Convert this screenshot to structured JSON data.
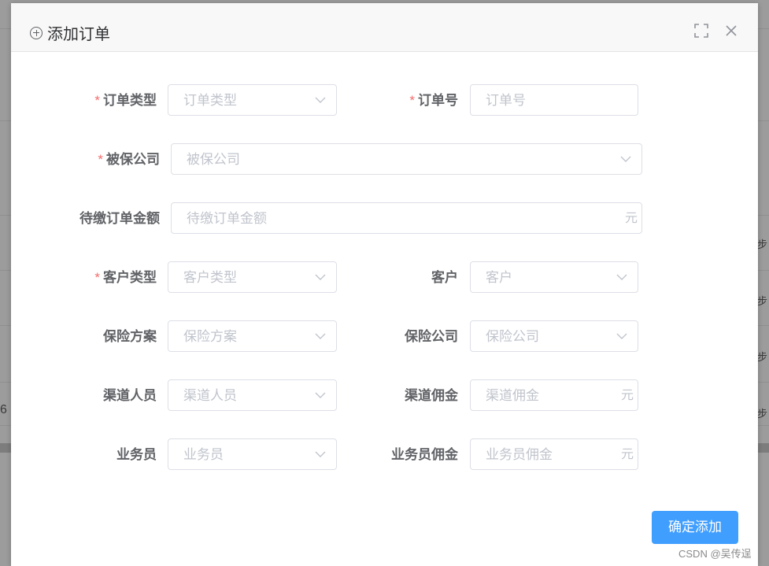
{
  "dialog": {
    "title": "添加订单",
    "submit_label": "确定添加"
  },
  "form": {
    "order_type": {
      "label": "订单类型",
      "placeholder": "订单类型",
      "required": true
    },
    "order_no": {
      "label": "订单号",
      "placeholder": "订单号",
      "required": true
    },
    "insured_company": {
      "label": "被保公司",
      "placeholder": "被保公司",
      "required": true
    },
    "pending_amount": {
      "label": "待缴订单金额",
      "placeholder": "待缴订单金额",
      "suffix": "元"
    },
    "customer_type": {
      "label": "客户类型",
      "placeholder": "客户类型",
      "required": true
    },
    "customer": {
      "label": "客户",
      "placeholder": "客户"
    },
    "insurance_plan": {
      "label": "保险方案",
      "placeholder": "保险方案"
    },
    "insurance_company": {
      "label": "保险公司",
      "placeholder": "保险公司"
    },
    "channel_person": {
      "label": "渠道人员",
      "placeholder": "渠道人员"
    },
    "channel_commission": {
      "label": "渠道佣金",
      "placeholder": "渠道佣金",
      "suffix": "元"
    },
    "salesperson": {
      "label": "业务员",
      "placeholder": "业务员"
    },
    "salesperson_commission": {
      "label": "业务员佣金",
      "placeholder": "业务员佣金",
      "suffix": "元"
    }
  },
  "background": {
    "edge_text": "6",
    "right_text": "步"
  },
  "watermark": "CSDN @吴传逞",
  "colors": {
    "primary": "#409eff",
    "required_star": "#f56c6c",
    "placeholder": "#c0c4cc",
    "label": "#606266"
  },
  "icons": {
    "title_icon": "circle-plus-icon",
    "fullscreen": "fullscreen-icon",
    "close": "close-icon",
    "select_arrow": "chevron-down-icon"
  }
}
